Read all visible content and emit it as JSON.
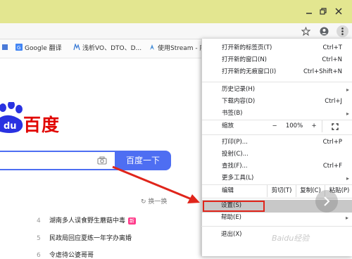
{
  "window": {
    "controls": [
      "minimize",
      "restore",
      "close"
    ]
  },
  "bookmarks": [
    {
      "label": "",
      "icon": "translate-icon"
    },
    {
      "label": "Google 翻译",
      "icon": "google-translate-icon"
    },
    {
      "label": "浅析VO、DTO、D...",
      "icon": "bookmark-icon"
    },
    {
      "label": "使用Stream - 廖",
      "icon": "bookmark-icon"
    }
  ],
  "baidu": {
    "logo_text": "百度",
    "logo_prefix": "du",
    "search_button": "百度一下",
    "refresh": "换一换",
    "hot": [
      {
        "num": "4",
        "text": "湖南多人误食野生蘑菇中毒",
        "badge": "新"
      },
      {
        "num": "5",
        "text": "民政局回应夏练一年字办离婚",
        "badge": ""
      },
      {
        "num": "6",
        "text": "令虐待公婆哥哥",
        "badge": ""
      }
    ]
  },
  "menu": {
    "items_top": [
      {
        "label": "打开新的标签页(T)",
        "shortcut": "Ctrl+T"
      },
      {
        "label": "打开新的窗口(N)",
        "shortcut": "Ctrl+N"
      },
      {
        "label": "打开新的无痕窗口(I)",
        "shortcut": "Ctrl+Shift+N"
      }
    ],
    "items_mid": [
      {
        "label": "历史记录(H)",
        "shortcut": "",
        "arrow": "▸"
      },
      {
        "label": "下载内容(D)",
        "shortcut": "Ctrl+J",
        "arrow": ""
      },
      {
        "label": "书签(B)",
        "shortcut": "",
        "arrow": "▸"
      }
    ],
    "zoom": {
      "label": "缩放",
      "minus": "−",
      "value": "100%",
      "plus": "+"
    },
    "items_tools": [
      {
        "label": "打印(P)...",
        "shortcut": "Ctrl+P",
        "arrow": ""
      },
      {
        "label": "投射(C)...",
        "shortcut": "",
        "arrow": ""
      },
      {
        "label": "查找(F)...",
        "shortcut": "Ctrl+F",
        "arrow": ""
      },
      {
        "label": "更多工具(L)",
        "shortcut": "",
        "arrow": "▸"
      }
    ],
    "edit": {
      "label": "编辑",
      "cut": "剪切(T)",
      "copy": "复制(C)",
      "paste": "粘贴(P)"
    },
    "items_bottom": [
      {
        "label": "设置(S)",
        "arrow": ""
      },
      {
        "label": "帮助(E)",
        "arrow": "▸"
      }
    ],
    "exit": "退出(X)"
  },
  "watermark": "Baidu经验",
  "colors": {
    "titlebar": "#e3e690",
    "baidu_blue": "#4e6ef2",
    "baidu_red": "#e10602",
    "annotation_red": "#e0251b"
  }
}
